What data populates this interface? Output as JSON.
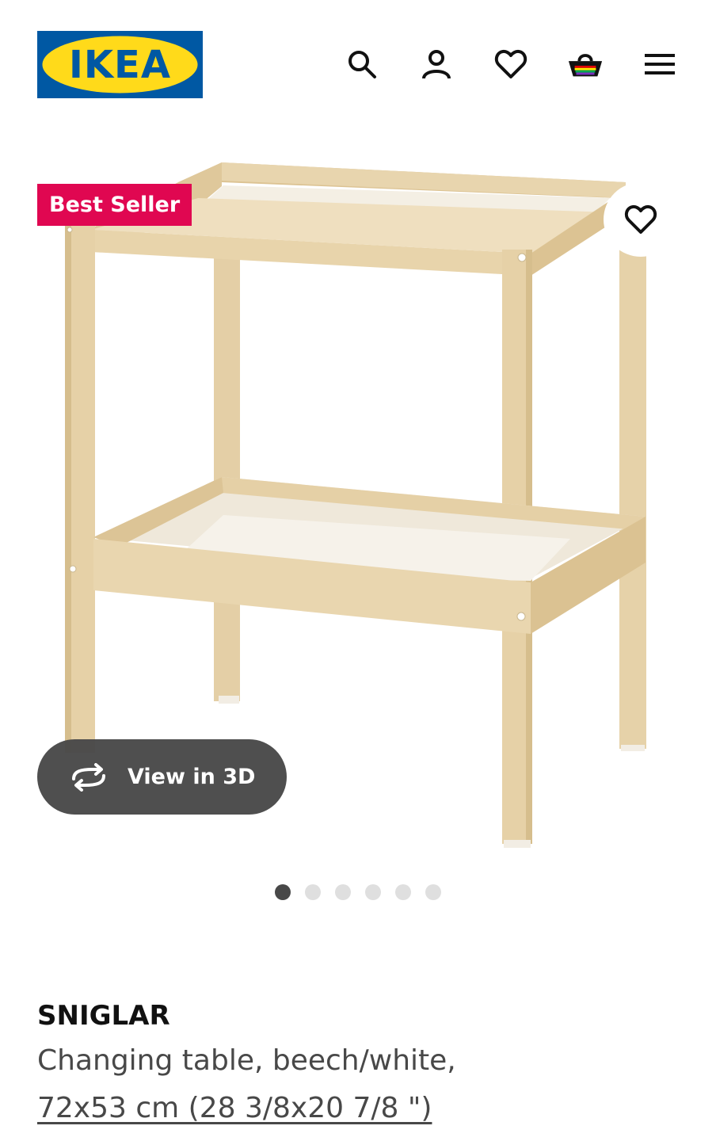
{
  "header": {
    "logo_text": "IKEA",
    "logo_colors": {
      "background": "#0058a3",
      "ellipse": "#ffda1a",
      "text": "#0058a3"
    },
    "icons": [
      "search-icon",
      "profile-icon",
      "heart-icon",
      "shopping-bag-icon",
      "menu-icon"
    ]
  },
  "gallery": {
    "badge": "Best Seller",
    "badge_color": "#e00751",
    "favourite_icon": "heart-icon",
    "view_3d_label": "View in 3D",
    "view_3d_icon": "rotate-3d-icon",
    "slide_count": 6,
    "active_slide": 1
  },
  "product": {
    "name": "SNIGLAR",
    "description": "Changing table, beech/white,",
    "size": "72x53 cm (28 3/8x20 7/8 \")"
  }
}
